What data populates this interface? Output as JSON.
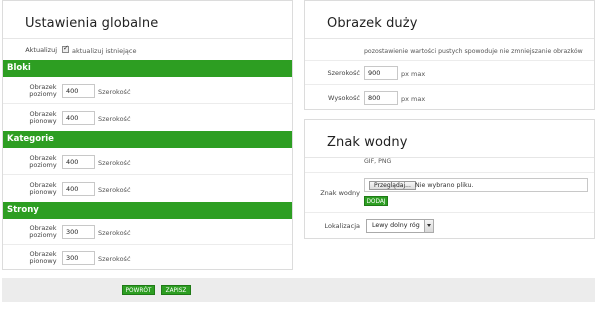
{
  "global": {
    "title": "Ustawienia globalne",
    "update_label": "Aktualizuj",
    "update_checkbox_label": "aktualizuj istniejące",
    "sections": [
      {
        "name": "Bloki",
        "rows": [
          {
            "label": "Obrazek poziomy",
            "value": "400",
            "unit": "Szerokość"
          },
          {
            "label": "Obrazek pionowy",
            "value": "400",
            "unit": "Szerokość"
          }
        ]
      },
      {
        "name": "Kategorie",
        "rows": [
          {
            "label": "Obrazek poziomy",
            "value": "400",
            "unit": "Szerokość"
          },
          {
            "label": "Obrazek pionowy",
            "value": "400",
            "unit": "Szerokość"
          }
        ]
      },
      {
        "name": "Strony",
        "rows": [
          {
            "label": "Obrazek poziomy",
            "value": "300",
            "unit": "Szerokość"
          },
          {
            "label": "Obrazek pionowy",
            "value": "300",
            "unit": "Szerokość"
          }
        ]
      }
    ]
  },
  "large_image": {
    "title": "Obrazek duży",
    "note": "pozostawienie wartości pustych spowoduje nie zmniejszanie obrazków",
    "width_label": "Szerokość",
    "width_value": "900",
    "width_unit": "px max",
    "height_label": "Wysokość",
    "height_value": "800",
    "height_unit": "px max"
  },
  "watermark": {
    "title": "Znak wodny",
    "formats": "GIF, PNG",
    "file_label": "Znak wodny",
    "browse_label": "Przeglądaj...",
    "no_file_text": "Nie wybrano pliku.",
    "add_label": "DODAJ",
    "location_label": "Lokalizacja",
    "location_value": "Lewy dolny róg"
  },
  "footer": {
    "back_label": "POWRÓT",
    "save_label": "ZAPISZ"
  },
  "colors": {
    "accent_green": "#2d9e22"
  }
}
